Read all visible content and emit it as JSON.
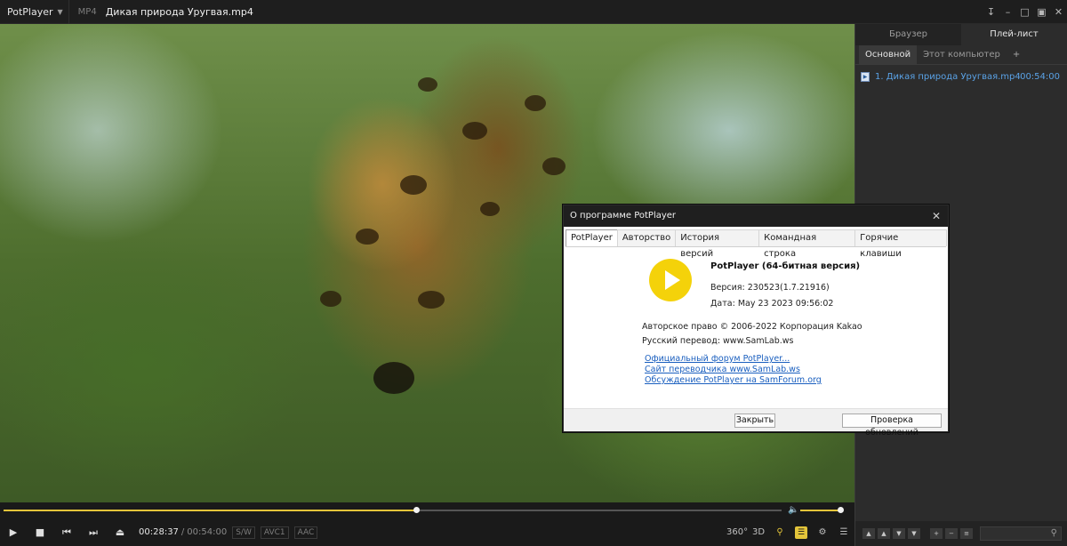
{
  "titlebar": {
    "app_name": "PotPlayer",
    "format": "MP4",
    "file_title": "Дикая природа Уругвая.mp4",
    "controls": [
      "pin-icon",
      "minimize-icon",
      "maximize-icon",
      "fullscreen-icon",
      "close-icon"
    ]
  },
  "player": {
    "current_time": "00:28:37",
    "separator": "/",
    "total_time": "00:54:00",
    "tags": [
      "S/W",
      "AVC1",
      "AAC"
    ],
    "progress": 0.53,
    "volume": 0.94,
    "extra_labels": {
      "vr": "360°",
      "three_d": "3D"
    }
  },
  "panel": {
    "tabs": [
      "Браузер",
      "Плей-лист"
    ],
    "active_tab": 1,
    "subtabs": [
      "Основной",
      "Этот компьютер",
      "+"
    ],
    "active_subtab": 0,
    "items": [
      {
        "name": "1. Дикая природа Уругвая.mp4",
        "duration": "00:54:00"
      }
    ]
  },
  "dialog": {
    "title": "О программе PotPlayer",
    "tabs": [
      "PotPlayer",
      "Авторство",
      "История версий",
      "Командная строка",
      "Горячие клавиши"
    ],
    "active_tab": 0,
    "product": "PotPlayer (64-битная версия)",
    "version": "Версия: 230523(1.7.21916)",
    "date": "Дата: May 23 2023 09:56:02",
    "copyright": "Авторское право © 2006-2022 Корпорация Kakao",
    "translation": "Русский перевод: www.SamLab.ws",
    "links": [
      "Официальный форум PotPlayer...",
      "Сайт переводчика www.SamLab.ws",
      "Обсуждение PotPlayer на SamForum.org"
    ],
    "close_button": "Закрыть",
    "update_button": "Проверка обновлений"
  },
  "colors": {
    "accent": "#e3c43a",
    "playlist_link": "#5aa2e6",
    "dialog_link": "#1a5fbf",
    "logo": "#f4d20a"
  }
}
